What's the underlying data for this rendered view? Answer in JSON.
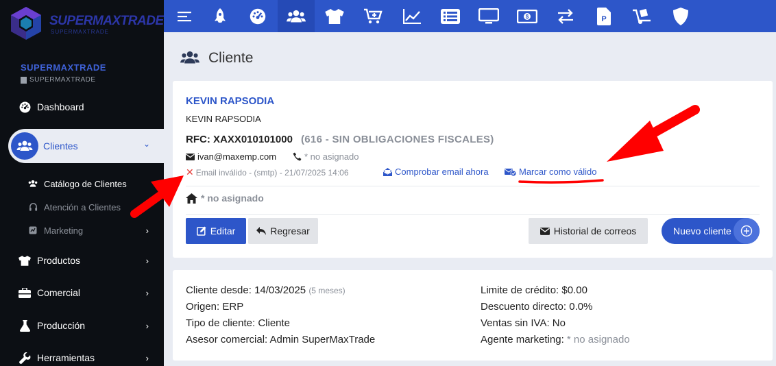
{
  "brand": {
    "logo_text": "SUPERMAXTRADE",
    "logo_sub": "SUPERMAXTRADE",
    "company": "SUPERMAXTRADE",
    "company_sub": "SUPERMAXTRADE"
  },
  "sidebar": {
    "items": [
      {
        "label": "Dashboard",
        "icon": "dashboard-gauge-icon"
      },
      {
        "label": "Clientes",
        "icon": "users-icon"
      },
      {
        "label": "Catálogo de Clientes",
        "icon": "users-icon"
      },
      {
        "label": "Atención a Clientes",
        "icon": "headset-icon"
      },
      {
        "label": "Marketing",
        "icon": "marketing-icon"
      },
      {
        "label": "Productos",
        "icon": "tshirt-icon"
      },
      {
        "label": "Comercial",
        "icon": "briefcase-icon"
      },
      {
        "label": "Producción",
        "icon": "flask-icon"
      },
      {
        "label": "Herramientas",
        "icon": "wrench-icon"
      }
    ]
  },
  "topbar": {
    "icons": [
      "menu-icon",
      "rocket-icon",
      "gauge-icon",
      "users-icon",
      "tshirt-icon",
      "cart-plus-icon",
      "chart-line-icon",
      "list-icon",
      "desktop-icon",
      "money-icon",
      "exchange-icon",
      "file-invoice-icon",
      "dolly-icon",
      "shield-icon"
    ],
    "active_index": 3
  },
  "page": {
    "title": "Cliente"
  },
  "customer": {
    "name": "KEVIN RAPSODIA",
    "name2": "KEVIN RAPSODIA",
    "rfc": "RFC: XAXX010101000",
    "regime": "(616 - SIN OBLIGACIONES FISCALES)",
    "email": "ivan@maxemp.com",
    "phone": "* no asignado",
    "email_status": "Email inválido - (smtp) - 21/07/2025 14:06",
    "check_email_label": "Comprobar email ahora",
    "mark_valid_label": "Marcar como válido",
    "address": "* no asignado"
  },
  "buttons": {
    "edit": "Editar",
    "back": "Regresar",
    "mail_history": "Historial de correos",
    "new_client": "Nuevo cliente"
  },
  "details": {
    "since_label": "Cliente desde: 14/03/2025",
    "since_ago": "(5 meses)",
    "origin": "Origen: ERP",
    "type": "Tipo de cliente: Cliente",
    "advisor": "Asesor comercial: Admin SuperMaxTrade",
    "credit": "Limite de crédito: $0.00",
    "discount": "Descuento directo: 0.0%",
    "no_vat": "Ventas sin IVA: No",
    "marketing_label": "Agente marketing:",
    "marketing_value": "* no asignado"
  },
  "colors": {
    "primary": "#2d56c9",
    "sidebar_bg": "#0c0f14",
    "page_bg": "#e9ecf3",
    "annotation_red": "#ff0000"
  }
}
